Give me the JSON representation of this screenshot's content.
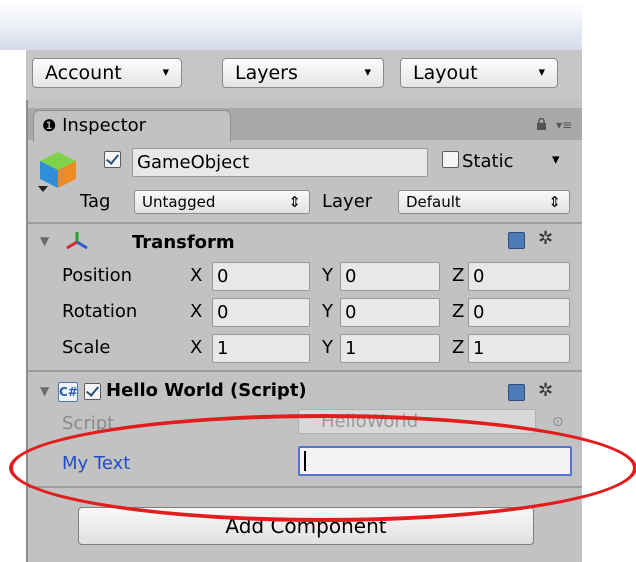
{
  "toolbar": {
    "account_label": "Account",
    "layers_label": "Layers",
    "layout_label": "Layout",
    "dropdown_arrow": "▾"
  },
  "tab": {
    "info_glyph": "❶",
    "title": "Inspector",
    "lock_glyph": "🔒",
    "menu_glyph": "▾≡"
  },
  "gameobject": {
    "name": "GameObject",
    "active_checked": true,
    "static_label": "Static",
    "static_checked": false,
    "tag_label": "Tag",
    "tag_value": "Untagged",
    "layer_label": "Layer",
    "layer_value": "Default",
    "updown_glyph": "⇕"
  },
  "transform": {
    "title": "Transform",
    "rows": [
      {
        "label": "Position",
        "x": "0",
        "y": "0",
        "z": "0"
      },
      {
        "label": "Rotation",
        "x": "0",
        "y": "0",
        "z": "0"
      },
      {
        "label": "Scale",
        "x": "1",
        "y": "1",
        "z": "1"
      }
    ],
    "axis_x": "X",
    "axis_y": "Y",
    "axis_z": "Z"
  },
  "script_component": {
    "title": "Hello World (Script)",
    "enabled_checked": true,
    "script_label": "Script",
    "script_value": "HelloWorld",
    "target_glyph": "⊙",
    "mytext_label": "My Text",
    "mytext_value": ""
  },
  "add_component_label": "Add Component",
  "colors": {
    "highlight_oval": "#e21d1d",
    "focused_label": "#1f4fc7",
    "panel_bg": "#c2c2c2"
  }
}
